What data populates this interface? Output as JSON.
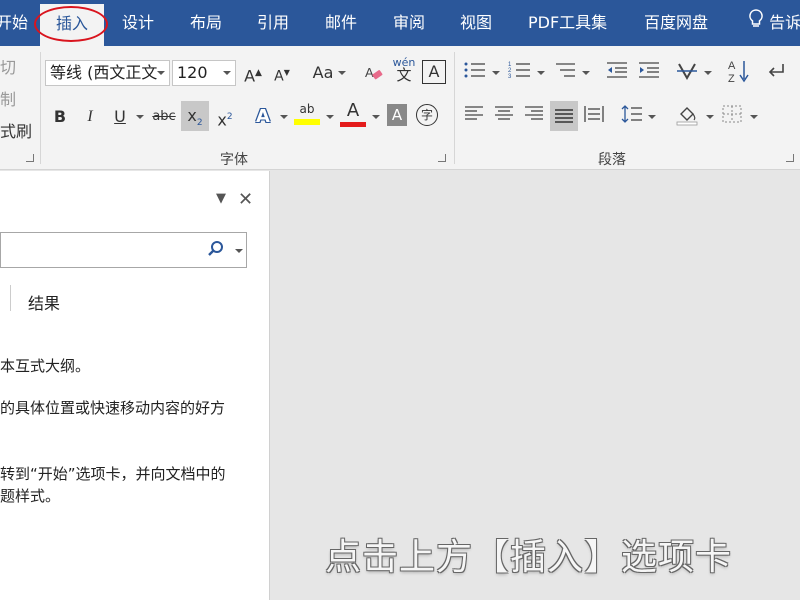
{
  "tabs": {
    "home": "开始",
    "insert": "插入",
    "design": "设计",
    "layout": "布局",
    "references": "引用",
    "mailings": "邮件",
    "review": "审阅",
    "view": "视图",
    "pdf": "PDF工具集",
    "baidu": "百度网盘",
    "tellme": "告诉"
  },
  "clipboard": {
    "cut": "切",
    "copy": "制",
    "format_painter": "式刷"
  },
  "font": {
    "name": "等线 (西文正文",
    "size": "120",
    "grow": "A",
    "shrink": "A",
    "case": "Aa",
    "phonetic_top": "wén",
    "phonetic_bottom": "文",
    "border_char": "A",
    "bold": "B",
    "italic": "I",
    "underline": "U",
    "strike": "abc",
    "sub": "x",
    "sub_mark": "2",
    "sup": "x",
    "sup_mark": "2",
    "effects": "A",
    "highlight": "ab",
    "color": "A",
    "shading": "A",
    "enclose": "字",
    "group_label": "字体"
  },
  "paragraph": {
    "sort": "A↓Z",
    "group_label": "段落"
  },
  "colors": {
    "ribbon_blue": "#2b579a",
    "highlight_yellow": "#ffff00",
    "font_red": "#e41b1b",
    "annotation_red": "#d9141e"
  },
  "nav_pane": {
    "results_tab": "结果",
    "line1": "本互式大纲。",
    "line2": "的具体位置或快速移动内容的好方",
    "line3": "转到“开始”选项卡，并向文档中的",
    "line4": "题样式。",
    "dropdown_icon": "▼",
    "close_icon": "✕",
    "search_icon": "⚲"
  },
  "caption": "点击上方【插入】选项卡"
}
